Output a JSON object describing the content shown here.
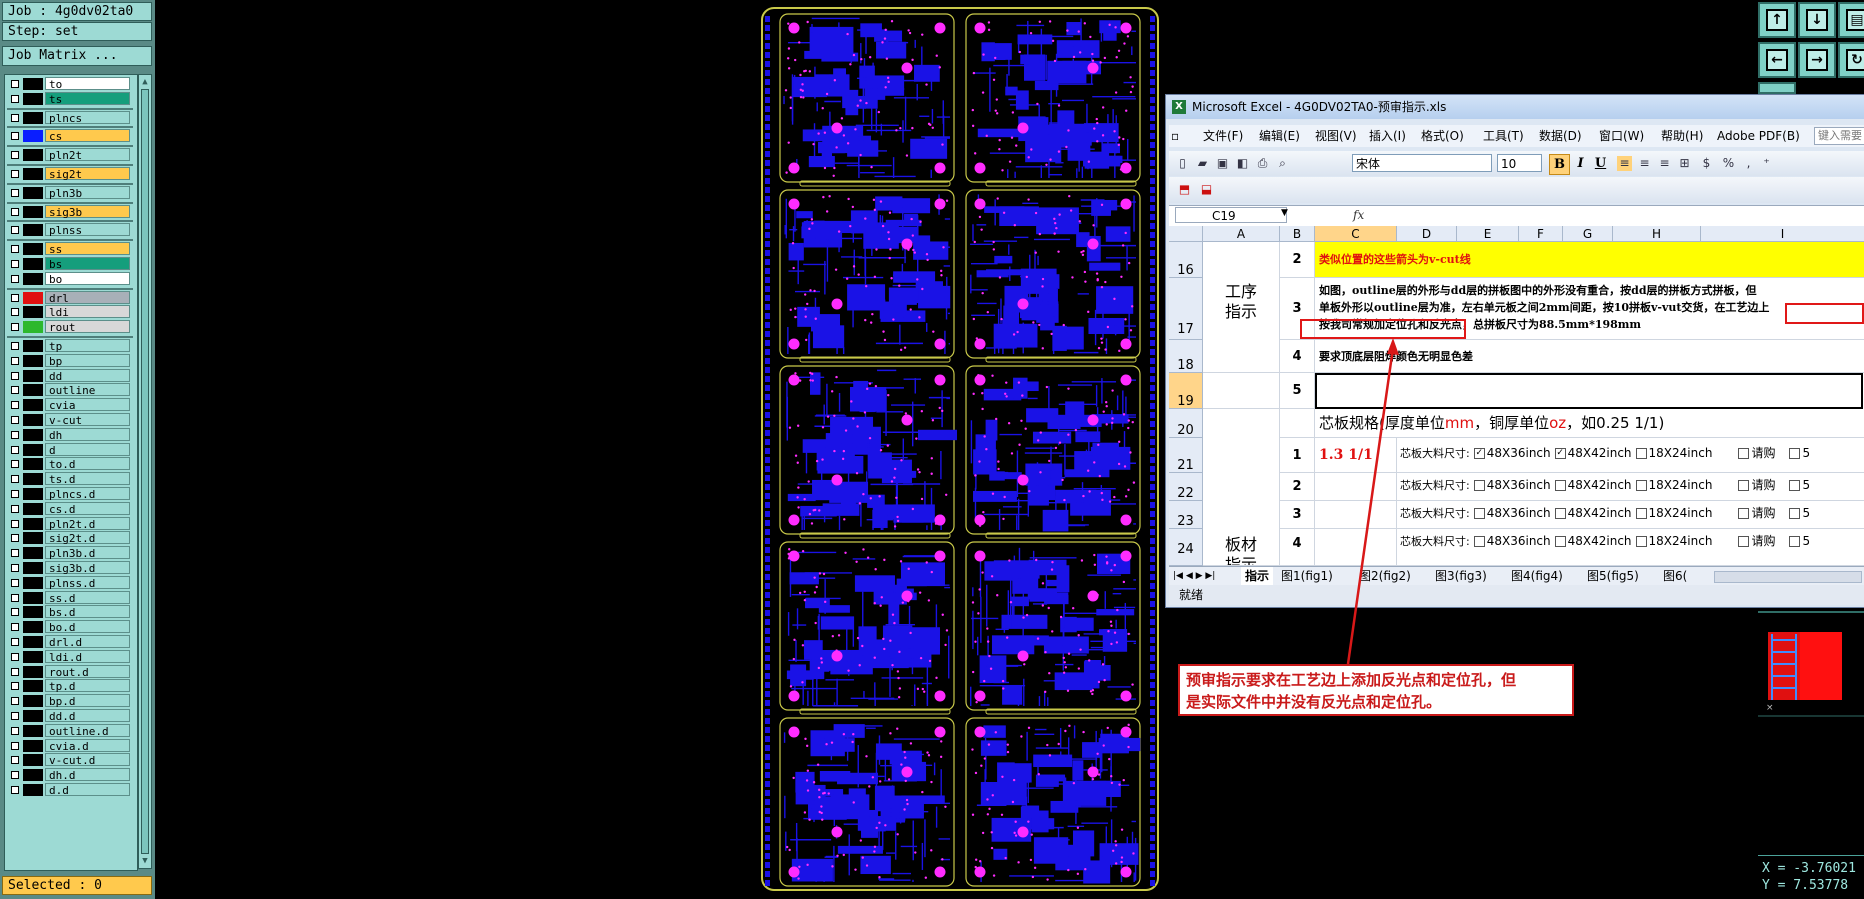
{
  "job_panel": {
    "job": "Job : 4g0dv02ta0",
    "step": "Step: set",
    "matrix_button": "Job Matrix ...",
    "selected": "Selected : 0",
    "layers": [
      {
        "name": "to",
        "bg": "#ffffff",
        "sw": "#000000",
        "gap": false
      },
      {
        "name": "ts",
        "bg": "#159e7c",
        "sw": "#000000",
        "gap": false
      },
      {
        "name": "plncs",
        "bg": "#9ddad4",
        "sw": "#000000",
        "gap": true
      },
      {
        "name": "cs",
        "bg": "#ffc94d",
        "sw": "#0a1eff",
        "gap": true
      },
      {
        "name": "pln2t",
        "bg": "#9ddad4",
        "sw": "#000000",
        "gap": true
      },
      {
        "name": "sig2t",
        "bg": "#ffc94d",
        "sw": "#000000",
        "gap": true
      },
      {
        "name": "pln3b",
        "bg": "#9ddad4",
        "sw": "#000000",
        "gap": true
      },
      {
        "name": "sig3b",
        "bg": "#ffc94d",
        "sw": "#000000",
        "gap": true
      },
      {
        "name": "plnss",
        "bg": "#9ddad4",
        "sw": "#000000",
        "gap": true
      },
      {
        "name": "ss",
        "bg": "#ffc94d",
        "sw": "#000000",
        "gap": true
      },
      {
        "name": "bs",
        "bg": "#159e7c",
        "sw": "#000000",
        "gap": false
      },
      {
        "name": "bo",
        "bg": "#ffffff",
        "sw": "#000000",
        "gap": false
      },
      {
        "name": "drl",
        "bg": "#a8b0b8",
        "sw": "#e01010",
        "gap": true
      },
      {
        "name": "ldi",
        "bg": "#d8d8d8",
        "sw": "#000000",
        "gap": false
      },
      {
        "name": "rout",
        "bg": "#d8d8d8",
        "sw": "#2db82d",
        "gap": false
      },
      {
        "name": "tp",
        "bg": "#9ddad4",
        "sw": "#000000",
        "gap": true
      },
      {
        "name": "bp",
        "bg": "#9ddad4",
        "sw": "#000000",
        "gap": false
      },
      {
        "name": "dd",
        "bg": "#9ddad4",
        "sw": "#000000",
        "gap": false
      },
      {
        "name": "outline",
        "bg": "#9ddad4",
        "sw": "#000000",
        "gap": false
      },
      {
        "name": "cvia",
        "bg": "#9ddad4",
        "sw": "#000000",
        "gap": false
      },
      {
        "name": "v-cut",
        "bg": "#9ddad4",
        "sw": "#000000",
        "gap": false
      },
      {
        "name": "dh",
        "bg": "#9ddad4",
        "sw": "#000000",
        "gap": false
      },
      {
        "name": "d",
        "bg": "#9ddad4",
        "sw": "#000000",
        "gap": false
      },
      {
        "name": "to.d",
        "bg": "#9ddad4",
        "sw": "#000000",
        "gap": false
      },
      {
        "name": "ts.d",
        "bg": "#9ddad4",
        "sw": "#000000",
        "gap": false
      },
      {
        "name": "plncs.d",
        "bg": "#9ddad4",
        "sw": "#000000",
        "gap": false
      },
      {
        "name": "cs.d",
        "bg": "#9ddad4",
        "sw": "#000000",
        "gap": false
      },
      {
        "name": "pln2t.d",
        "bg": "#9ddad4",
        "sw": "#000000",
        "gap": false
      },
      {
        "name": "sig2t.d",
        "bg": "#9ddad4",
        "sw": "#000000",
        "gap": false
      },
      {
        "name": "pln3b.d",
        "bg": "#9ddad4",
        "sw": "#000000",
        "gap": false
      },
      {
        "name": "sig3b.d",
        "bg": "#9ddad4",
        "sw": "#000000",
        "gap": false
      },
      {
        "name": "plnss.d",
        "bg": "#9ddad4",
        "sw": "#000000",
        "gap": false
      },
      {
        "name": "ss.d",
        "bg": "#9ddad4",
        "sw": "#000000",
        "gap": false
      },
      {
        "name": "bs.d",
        "bg": "#9ddad4",
        "sw": "#000000",
        "gap": false
      },
      {
        "name": "bo.d",
        "bg": "#9ddad4",
        "sw": "#000000",
        "gap": false
      },
      {
        "name": "drl.d",
        "bg": "#9ddad4",
        "sw": "#000000",
        "gap": false
      },
      {
        "name": "ldi.d",
        "bg": "#9ddad4",
        "sw": "#000000",
        "gap": false
      },
      {
        "name": "rout.d",
        "bg": "#9ddad4",
        "sw": "#000000",
        "gap": false
      },
      {
        "name": "tp.d",
        "bg": "#9ddad4",
        "sw": "#000000",
        "gap": false
      },
      {
        "name": "bp.d",
        "bg": "#9ddad4",
        "sw": "#000000",
        "gap": false
      },
      {
        "name": "dd.d",
        "bg": "#9ddad4",
        "sw": "#000000",
        "gap": false
      },
      {
        "name": "outline.d",
        "bg": "#9ddad4",
        "sw": "#000000",
        "gap": false
      },
      {
        "name": "cvia.d",
        "bg": "#9ddad4",
        "sw": "#000000",
        "gap": false
      },
      {
        "name": "v-cut.d",
        "bg": "#9ddad4",
        "sw": "#000000",
        "gap": false
      },
      {
        "name": "dh.d",
        "bg": "#9ddad4",
        "sw": "#000000",
        "gap": false
      },
      {
        "name": "d.d",
        "bg": "#9ddad4",
        "sw": "#000000",
        "gap": false
      }
    ]
  },
  "excel": {
    "title": "Microsoft Excel - 4G0DV02TA0-预审指示.xls",
    "menu": [
      "文件(F)",
      "编辑(E)",
      "视图(V)",
      "插入(I)",
      "格式(O)",
      "工具(T)",
      "数据(D)",
      "窗口(W)",
      "帮助(H)",
      "Adobe PDF(B)"
    ],
    "help_placeholder": "键入需要",
    "font_name": "宋体",
    "font_size": "10",
    "name_box": "C19",
    "fx": "fx",
    "columns": [
      "A",
      "B",
      "C",
      "D",
      "E",
      "F",
      "G",
      "H",
      "I"
    ],
    "row_labels": [
      "16",
      "17",
      "18",
      "19",
      "20",
      "21",
      "22",
      "23",
      "24"
    ],
    "group_process": "工序\n指示",
    "group_board": "板材\n指示",
    "rows": {
      "r16_num": "2",
      "r16_text": "类似位置的这些箭头为v-cut线",
      "r17_num": "3",
      "r17_line1": "如图，outline层的外形与dd层的拼板图中的外形没有重合，按dd层的拼板方式拼板，但",
      "r17_line2a": "单板外形以outline层为准，左右单元板之间2mm间距，按10拼板v-vut交货，",
      "r17_line2b": "在工艺边上",
      "r17_line3a": "按我司常规加定位孔和反光点，",
      "r17_line3b": "总拼板尺寸为88.5mm*198mm",
      "r18_num": "4",
      "r18_text": "要求顶底层阻焊颜色无明显色差",
      "r19_num": "5",
      "r20_a": "芯板规格(厚度单位",
      "r20_mm": "mm",
      "r20_b": "，铜厚单位",
      "r20_oz": "oz",
      "r20_c": "，如0.25 1/1)",
      "r21_num": "1",
      "r21_spec": "1.3 1/1",
      "r22_num": "2",
      "r23_num": "3",
      "r24_num": "4",
      "size_label": "芯板大料尺寸:",
      "opt1": "48X36inch",
      "opt2": "48X42inch",
      "opt3": "18X24inch",
      "opt4": "请购",
      "opt5": "5"
    },
    "sheet_tabs": [
      "指示",
      "图1(fig1)",
      "图2(fig2)",
      "图3(fig3)",
      "图4(fig4)",
      "图5(fig5)",
      "图6("
    ],
    "status": "就绪"
  },
  "callout": {
    "line1": "预审指示要求在工艺边上添加反光点和定位孔，但",
    "line2": "是实际文件中并没有反光点和定位孔。"
  },
  "coords": {
    "x": "X = -3.76021",
    "y": "Y = 7.53778"
  },
  "colors": {
    "pcb_copper": "#1a12e6",
    "pcb_pad": "#ff2cff",
    "pcb_outline": "#c9c94a",
    "panel_teal": "#9ddad4",
    "callout_red": "#c91a1a"
  }
}
